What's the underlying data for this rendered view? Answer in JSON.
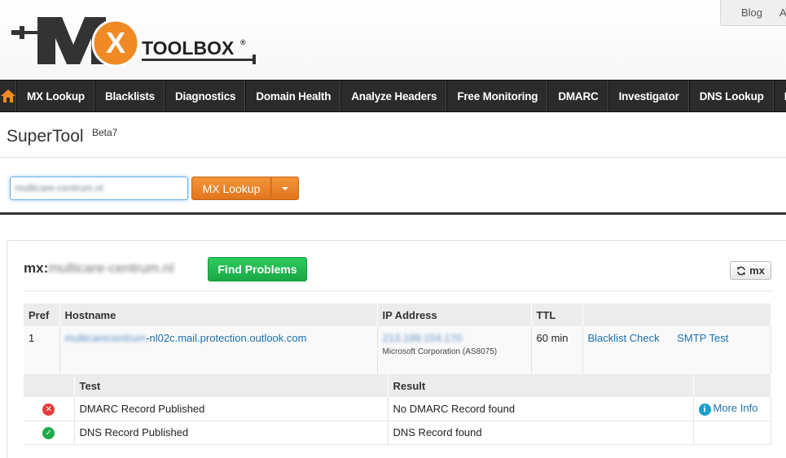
{
  "header": {
    "top_links": [
      "Blog",
      "A"
    ],
    "logo_text": "TOOLBOX®",
    "logo_letters": "MX"
  },
  "nav": {
    "items": [
      "MX Lookup",
      "Blacklists",
      "Diagnostics",
      "Domain Health",
      "Analyze Headers",
      "Free Monitoring",
      "DMARC",
      "Investigator",
      "DNS Lookup",
      "M"
    ]
  },
  "supertool": {
    "title": "SuperTool",
    "beta": "Beta7",
    "input_value": "multicare-centrum.nl",
    "lookup_button": "MX Lookup"
  },
  "result": {
    "prefix": "mx:",
    "domain": "multicare-centrum.nl",
    "find_button": "Find Problems",
    "refresh_button": "mx"
  },
  "records_table": {
    "headers": [
      "Pref",
      "Hostname",
      "IP Address",
      "TTL",
      ""
    ],
    "row": {
      "pref": "1",
      "hostname_blurred": "multicarecentrum",
      "hostname_suffix": "-nl02c.mail.protection.outlook.com",
      "ip": "213.199.154.170",
      "ip_owner": "Microsoft Corporation (AS8075)",
      "ttl": "60 min",
      "blacklist_link": "Blacklist Check",
      "smtp_link": "SMTP Test"
    }
  },
  "tests_table": {
    "headers": [
      "",
      "Test",
      "Result",
      ""
    ],
    "rows": [
      {
        "status": "fail",
        "test": "DMARC Record Published",
        "result": "No DMARC Record found",
        "more": "More Info"
      },
      {
        "status": "pass",
        "test": "DNS Record Published",
        "result": "DNS Record found",
        "more": ""
      }
    ]
  }
}
